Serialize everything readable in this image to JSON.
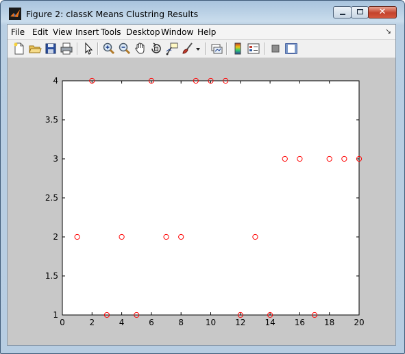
{
  "window": {
    "title": "Figure 2: classK Means Clustring Results"
  },
  "menu": [
    "File",
    "Edit",
    "View",
    "Insert",
    "Tools",
    "Desktop",
    "Window",
    "Help"
  ],
  "toolbar_icons": [
    "new-figure-icon",
    "open-file-icon",
    "save-icon",
    "print-icon",
    "edit-plot-arrow-icon",
    "zoom-in-icon",
    "zoom-out-icon",
    "pan-hand-icon",
    "rotate-3d-icon",
    "data-cursor-icon",
    "brush-icon",
    "brush-dropdown-icon",
    "link-plot-icon",
    "colorbar-icon",
    "legend-icon",
    "hide-plot-tools-icon",
    "show-plot-tools-icon"
  ],
  "colors": {
    "marker": "#ff0000",
    "axes_bg": "#ffffff",
    "figure_bg": "#c8c8c8"
  },
  "chart_data": {
    "type": "scatter",
    "marker": "circle",
    "x": [
      1,
      2,
      3,
      4,
      5,
      6,
      7,
      8,
      9,
      10,
      11,
      12,
      13,
      14,
      15,
      16,
      17,
      18,
      19,
      20
    ],
    "y": [
      2,
      4,
      1,
      2,
      1,
      4,
      2,
      2,
      4,
      4,
      4,
      1,
      2,
      1,
      3,
      3,
      1,
      3,
      3,
      3
    ],
    "xlim": [
      0,
      20
    ],
    "ylim": [
      1,
      4
    ],
    "xticks": [
      "0",
      "2",
      "4",
      "6",
      "8",
      "10",
      "12",
      "14",
      "16",
      "18",
      "20"
    ],
    "yticks": [
      "1",
      "1.5",
      "2",
      "2.5",
      "3",
      "3.5",
      "4"
    ],
    "grid": false
  }
}
